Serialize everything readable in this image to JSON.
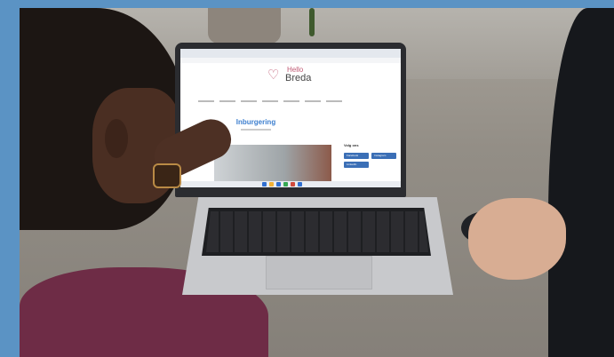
{
  "screen_site": {
    "logo_line1": "Hello",
    "logo_line2": "Breda",
    "page_title": "Inburgering",
    "sidebar_heading": "Volg ons",
    "social_buttons": [
      "Facebook",
      "Instagram",
      "LinkedIn"
    ]
  },
  "colors": {
    "background_frame": "#5b93c4",
    "logo_accent": "#c05a74",
    "title_blue": "#3d7fcf",
    "social_button": "#3b6fb6"
  }
}
